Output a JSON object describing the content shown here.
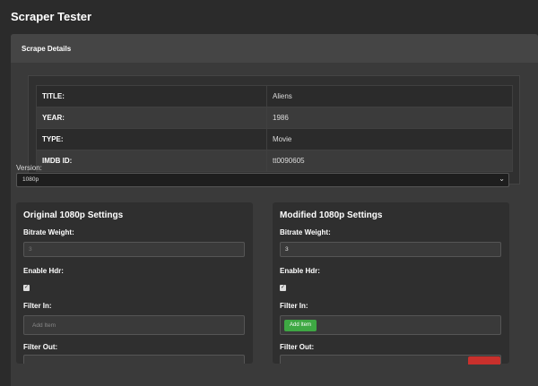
{
  "app": {
    "title": "Scraper Tester"
  },
  "card": {
    "header": "Scrape Details"
  },
  "details": [
    {
      "label": "TITLE:",
      "value": "Aliens"
    },
    {
      "label": "YEAR:",
      "value": "1986"
    },
    {
      "label": "TYPE:",
      "value": "Movie"
    },
    {
      "label": "IMDB ID:",
      "value": "tt0090605"
    }
  ],
  "version": {
    "label": "Version:",
    "selected": "1080p",
    "chevron_icon": "chevron-down-icon"
  },
  "original": {
    "title": "Original 1080p Settings",
    "bitrate_label": "Bitrate Weight:",
    "bitrate_value": "3",
    "hdr_label": "Enable Hdr:",
    "hdr_checked": true,
    "filter_in_label": "Filter In:",
    "filter_in_placeholder": "Add Item",
    "filter_out_label": "Filter Out:"
  },
  "modified": {
    "title": "Modified 1080p Settings",
    "bitrate_label": "Bitrate Weight:",
    "bitrate_value": "3",
    "hdr_label": "Enable Hdr:",
    "hdr_checked": true,
    "filter_in_label": "Filter In:",
    "add_item_label": "Add Item",
    "filter_out_label": "Filter Out:"
  },
  "colors": {
    "add_button": "#3ea843",
    "remove_button": "#c9302c",
    "background": "#2b2b2b"
  }
}
